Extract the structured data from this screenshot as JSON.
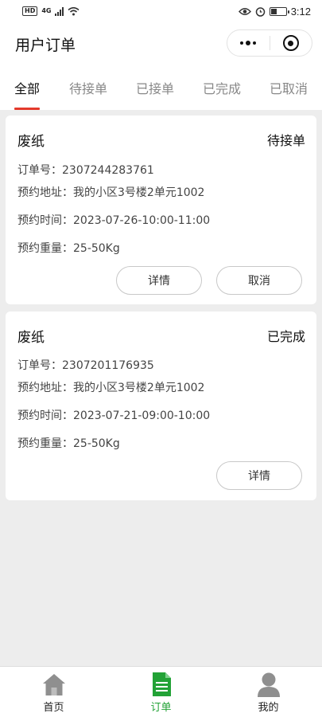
{
  "status_bar": {
    "left_badge": "HD",
    "network": "4G",
    "time": "3:12"
  },
  "header": {
    "title": "用户订单"
  },
  "tabs": [
    {
      "label": "全部",
      "active": true
    },
    {
      "label": "待接单",
      "active": false
    },
    {
      "label": "已接单",
      "active": false
    },
    {
      "label": "已完成",
      "active": false
    },
    {
      "label": "已取消",
      "active": false
    }
  ],
  "orders": [
    {
      "title": "废纸",
      "status": "待接单",
      "order_no_label": "订单号：",
      "order_no": "2307244283761",
      "address_label": "预约地址：",
      "address": "我的小区3号楼2单元1002",
      "time_label": "预约时间：",
      "time": "2023-07-26-10:00-11:00",
      "weight_label": "预约重量：",
      "weight": "25-50Kg",
      "buttons": [
        "详情",
        "取消"
      ]
    },
    {
      "title": "废纸",
      "status": "已完成",
      "order_no_label": "订单号：",
      "order_no": "2307201176935",
      "address_label": "预约地址：",
      "address": "我的小区3号楼2单元1002",
      "time_label": "预约时间：",
      "time": "2023-07-21-09:00-10:00",
      "weight_label": "预约重量：",
      "weight": "25-50Kg",
      "buttons": [
        "详情"
      ]
    }
  ],
  "tabbar": [
    {
      "label": "首页",
      "icon": "home-icon",
      "active": false
    },
    {
      "label": "订单",
      "icon": "order-document-icon",
      "active": true
    },
    {
      "label": "我的",
      "icon": "user-icon",
      "active": false
    }
  ],
  "colors": {
    "accent_red": "#e4392b",
    "active_green": "#22a236",
    "background": "#ededed"
  }
}
